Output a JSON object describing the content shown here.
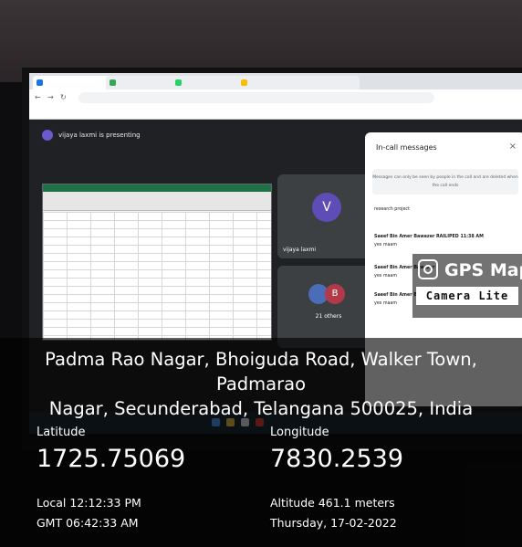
{
  "scene": {
    "presenting_text": "vijaya laxmi is presenting",
    "tiles": {
      "avatar_letter": "V",
      "avatar_name": "vijaya laxmi",
      "others_letter": "B",
      "others_label": "21 others"
    },
    "panel": {
      "title": "In-call messages",
      "close": "×",
      "note": "Messages can only be seen by people in the call and are deleted when the call ends",
      "messages": [
        "research project",
        "Saeef Bin Amer Bawazer RAILIPED  11:38 AM",
        "yes maam",
        "Saeef Bin Amer Bawazer",
        "yes maam",
        "Saeef Bin Amer Ba",
        "yes maam"
      ]
    }
  },
  "badge": {
    "title": "GPS Map",
    "subtitle": "Camera Lite"
  },
  "info": {
    "address_line1": "Padma Rao Nagar, Bhoiguda Road, Walker Town, Padmarao",
    "address_line2": "Nagar, Secunderabad, Telangana 500025, India",
    "latitude_label": "Latitude",
    "latitude_value": "1725.75069",
    "longitude_label": "Longitude",
    "longitude_value": "7830.2539",
    "local_time": "Local 12:12:33 PM",
    "gmt_time": "GMT 06:42:33 AM",
    "altitude": "Altitude 461.1 meters",
    "date": "Thursday, 17-02-2022"
  }
}
